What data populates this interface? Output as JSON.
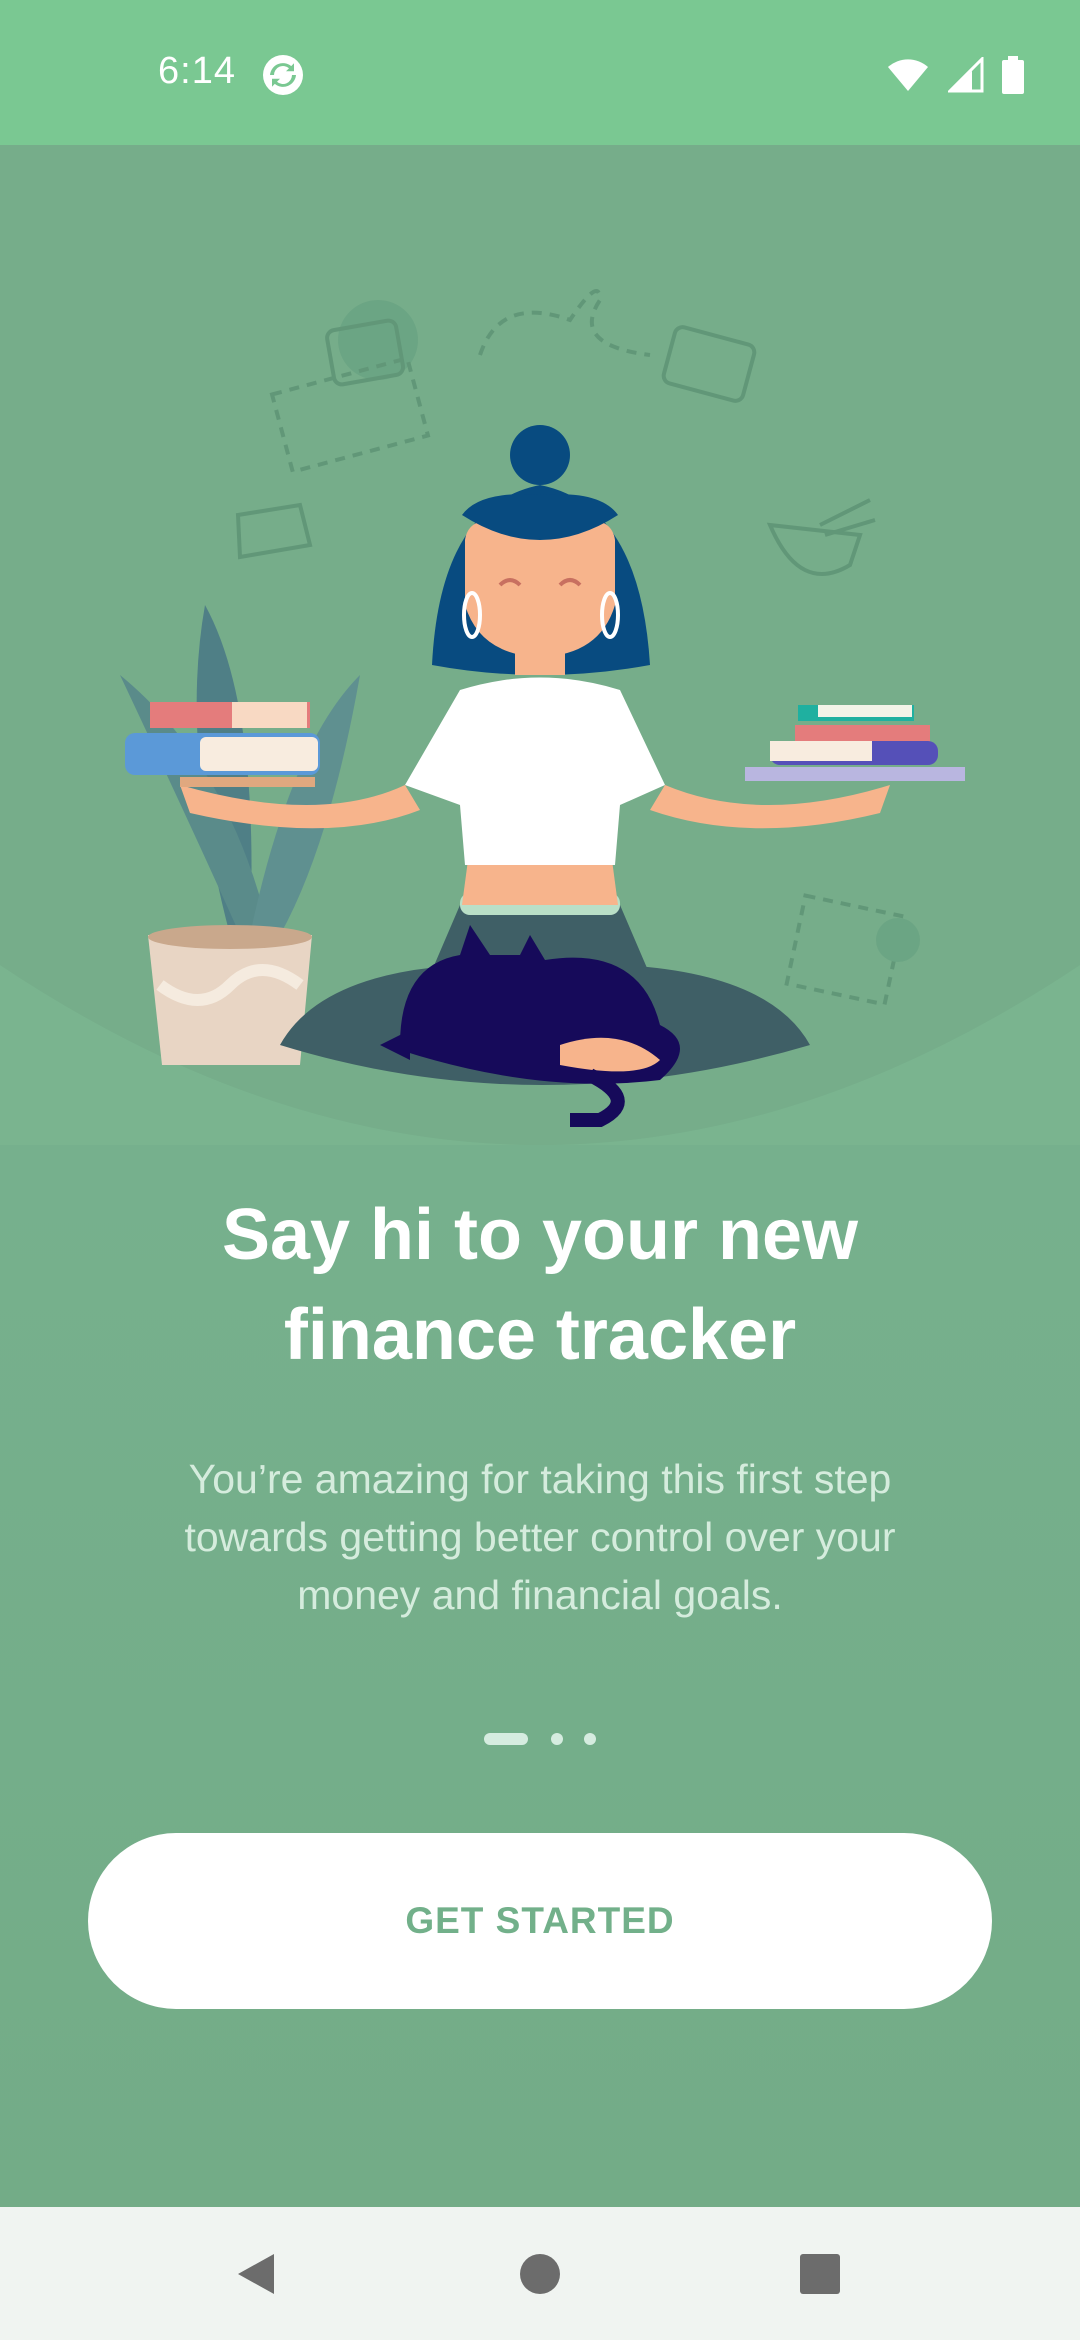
{
  "status_bar": {
    "time": "6:14",
    "app_icon": "sync-app-icon",
    "icons": [
      "wifi-icon",
      "cell-signal-icon",
      "battery-icon"
    ]
  },
  "onboarding": {
    "illustration": "meditating-woman-balancing-books-illustration",
    "headline_line1": "Say hi to your new",
    "headline_line2": "finance tracker",
    "description_line1": "You’re amazing for taking this first step",
    "description_line2": "towards getting better control over your",
    "description_line3": "money and financial goals.",
    "page_count": 3,
    "current_page": 1,
    "cta_label": "GET STARTED"
  },
  "nav_bar": {
    "icons": [
      "back-icon",
      "home-icon",
      "recents-icon"
    ]
  },
  "colors": {
    "status_bar": "#7ac892",
    "background": "#78b08c",
    "accent_text": "#72b08a",
    "button_bg": "#ffffff",
    "nav_bar": "#f0f4f1"
  }
}
